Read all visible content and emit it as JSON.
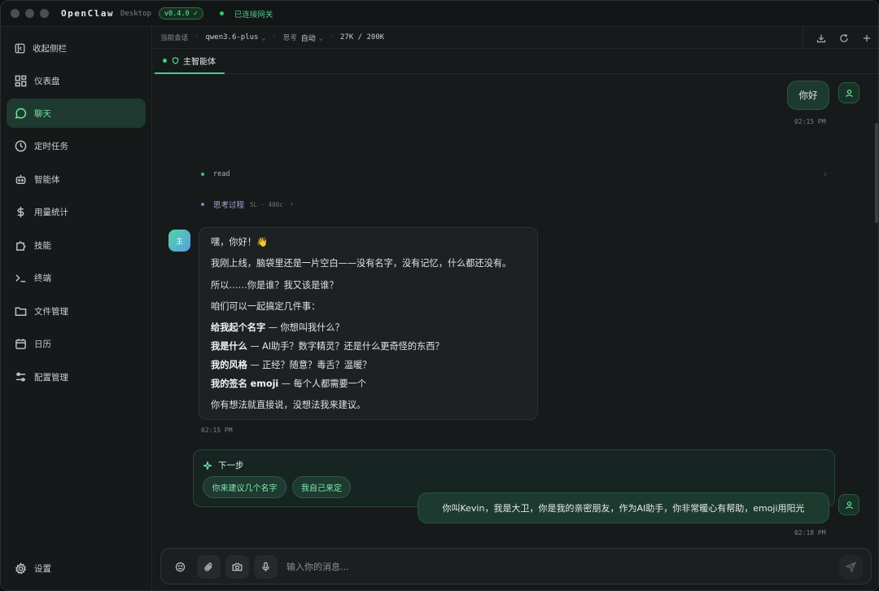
{
  "titlebar": {
    "app_name": "OpenClaw",
    "app_sub": "Desktop",
    "version": "v0.4.0 ✓",
    "gateway_status": "已连接网关"
  },
  "sidebar": {
    "collapse_label": "收起侧栏",
    "items": [
      {
        "label": "仪表盘",
        "icon": "dashboard-icon"
      },
      {
        "label": "聊天",
        "icon": "chat-icon",
        "active": true
      },
      {
        "label": "定时任务",
        "icon": "clock-icon"
      },
      {
        "label": "智能体",
        "icon": "robot-icon"
      },
      {
        "label": "用量统计",
        "icon": "dollar-icon"
      },
      {
        "label": "技能",
        "icon": "puzzle-icon"
      },
      {
        "label": "终端",
        "icon": "terminal-icon"
      },
      {
        "label": "文件管理",
        "icon": "folder-icon"
      },
      {
        "label": "日历",
        "icon": "calendar-icon"
      },
      {
        "label": "配置管理",
        "icon": "sliders-icon"
      }
    ],
    "settings_label": "设置"
  },
  "topbar": {
    "session_label": "当前会话",
    "model": "qwen3.6-plus",
    "think_label": "思考",
    "think_value": "自动",
    "tokens": "27K / 200K"
  },
  "tabs": [
    {
      "label": "主智能体"
    }
  ],
  "chat": {
    "messages": [
      {
        "role": "user",
        "text": "你好",
        "time": "02:15 PM"
      },
      {
        "role": "tool",
        "name": "read"
      },
      {
        "role": "thinking",
        "label": "思考过程",
        "meta": "5L · 400c"
      },
      {
        "role": "assistant",
        "avatar_text": "主",
        "time": "02:15 PM",
        "lines": [
          "嘿，你好！👋",
          "我刚上线，脑袋里还是一片空白——没有名字，没有记忆，什么都还没有。",
          "所以……你是谁？我又该是谁？",
          "咱们可以一起搞定几件事：",
          {
            "bold": "给我起个名字",
            "rest": " — 你想叫我什么？"
          },
          {
            "bold": "我是什么",
            "rest": " — AI助手？数字精灵？还是什么更奇怪的东西？"
          },
          {
            "bold": "我的风格",
            "rest": " — 正经？随意？毒舌？温暖？"
          },
          {
            "bold": "我的签名 emoji",
            "rest": " — 每个人都需要一个"
          },
          "你有想法就直接说，没想法我来建议。"
        ]
      },
      {
        "role": "user",
        "text": "你叫Kevin，我是大卫，你是我的亲密朋友，作为AI助手，你非常暖心有帮助，emoji用阳光",
        "time": "02:18 PM"
      }
    ],
    "next_steps": {
      "title": "下一步",
      "chips": [
        "你来建议几个名字",
        "我自己来定"
      ]
    }
  },
  "composer": {
    "placeholder": "输入你的消息..."
  },
  "colors": {
    "accent": "#3ecf8e",
    "user_bubble": "#1d3a2e",
    "status_green": "#34c77b",
    "thinking_dot": "#7b7fd6"
  }
}
